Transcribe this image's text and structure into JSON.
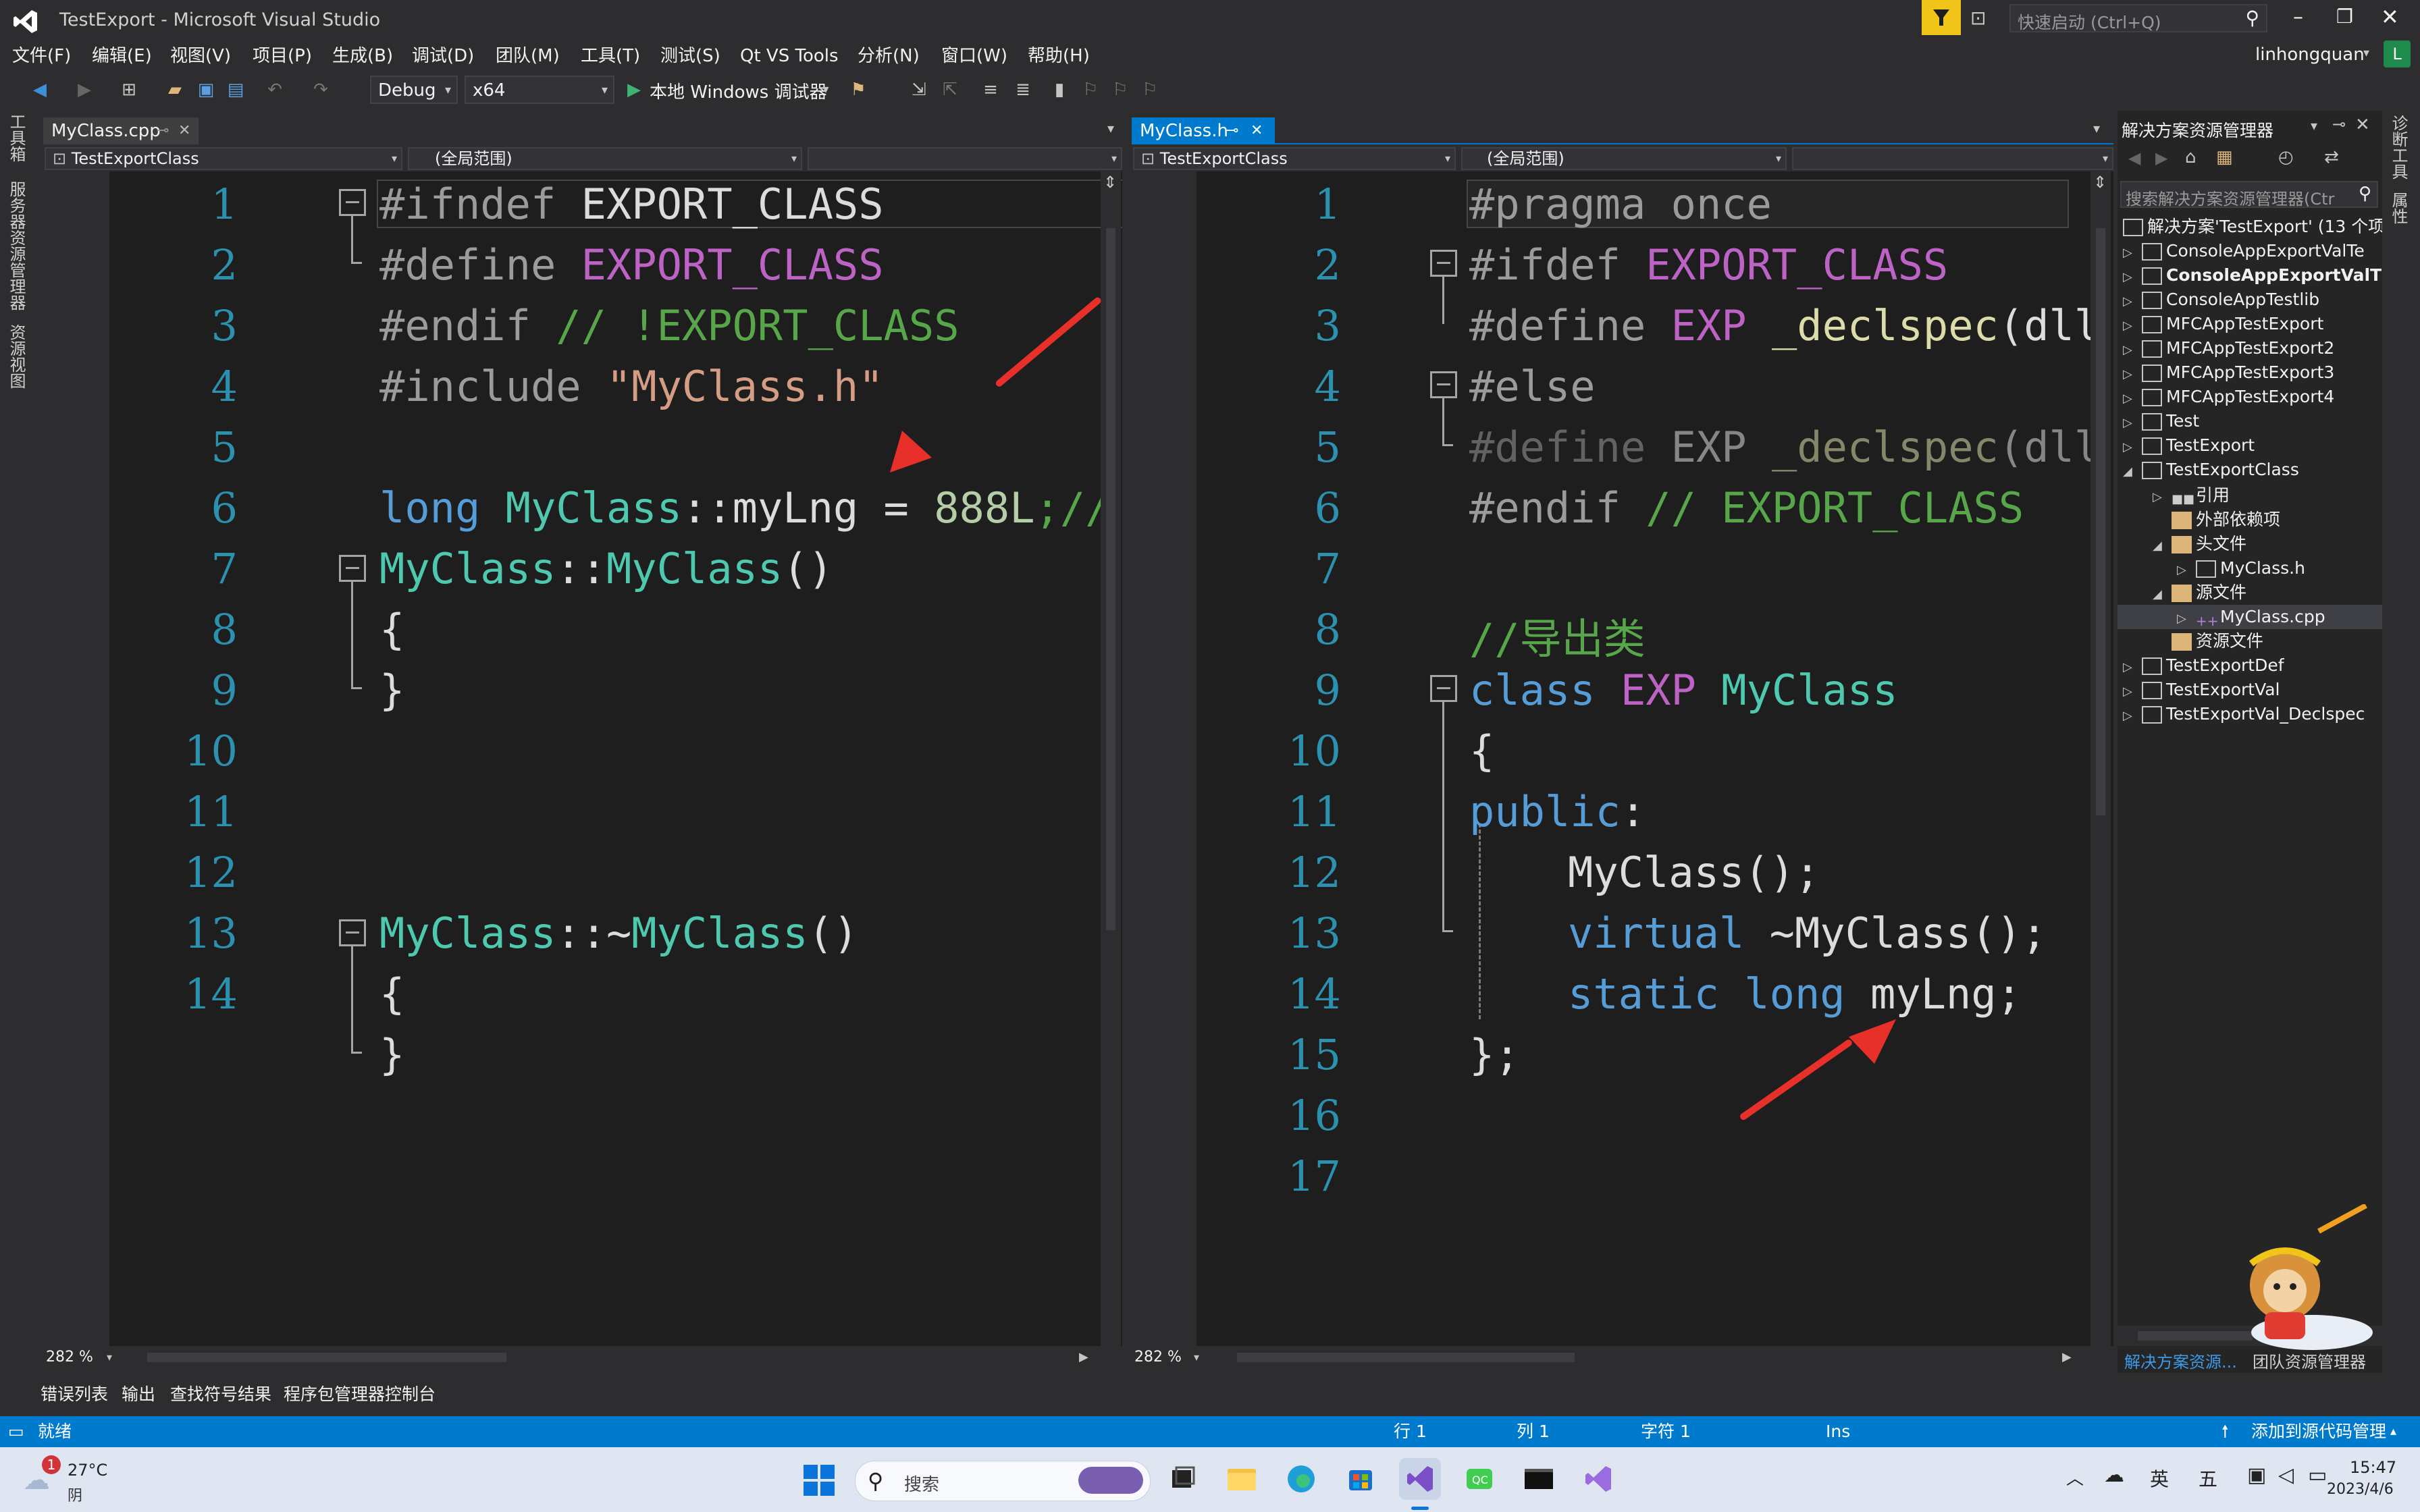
{
  "window": {
    "title": "TestExport - Microsoft Visual Studio",
    "quick_launch_placeholder": "快速启动 (Ctrl+Q)",
    "user": "linhongquan",
    "user_initial": "L"
  },
  "menu": [
    "文件(F)",
    "编辑(E)",
    "视图(V)",
    "项目(P)",
    "生成(B)",
    "调试(D)",
    "团队(M)",
    "工具(T)",
    "测试(S)",
    "Qt VS Tools",
    "分析(N)",
    "窗口(W)",
    "帮助(H)"
  ],
  "toolbar": {
    "config": "Debug",
    "platform": "x64",
    "debugger": "本地 Windows 调试器"
  },
  "left_strip": [
    "工具箱",
    "服务器资源管理器",
    "资源视图"
  ],
  "right_strip": [
    "诊断工具",
    "属性"
  ],
  "left_editor": {
    "tab": "MyClass.cpp",
    "nav_project": "TestExportClass",
    "nav_scope": "(全局范围)",
    "zoom": "282 %",
    "line_numbers": [
      "1",
      "2",
      "3",
      "4",
      "5",
      "6",
      "7",
      "8",
      "9",
      "10",
      "11",
      "12",
      "13",
      "14"
    ],
    "lines": {
      "l1": {
        "pp": "#ifndef ",
        "mac": "EXPORT_CLASS"
      },
      "l2": {
        "pp": "#define ",
        "mac": "EXPORT_CLASS"
      },
      "l3": {
        "pp": "#endif ",
        "cm": "// !EXPORT_CLASS"
      },
      "l4": {
        "pp": "#include ",
        "str": "\"MyClass.h\""
      },
      "l6": {
        "kw": "long ",
        "ty": "MyClass",
        "op": "::myLng = ",
        "num": "888L",
        "cm": ";//"
      },
      "l7": {
        "ty": "MyClass",
        "op": "::",
        "fn": "MyClass",
        "p": "()"
      },
      "l8": "{",
      "l9": "}",
      "l11": {
        "ty": "MyClass",
        "op": "::~",
        "fn": "MyClass",
        "p": "()"
      },
      "l12": "{",
      "l13": "}"
    }
  },
  "right_editor": {
    "tab": "MyClass.h",
    "nav_project": "TestExportClass",
    "nav_scope": "(全局范围)",
    "zoom": "282 %",
    "line_numbers": [
      "1",
      "2",
      "3",
      "4",
      "5",
      "6",
      "7",
      "8",
      "9",
      "10",
      "11",
      "12",
      "13",
      "14",
      "15",
      "16",
      "17"
    ],
    "lines": {
      "l1": {
        "pp": "#pragma once"
      },
      "l2": {
        "pp": "#ifdef ",
        "mac": "EXPORT_CLASS"
      },
      "l3": {
        "pp": "#define ",
        "mac": "EXP ",
        "fn": "_declspec",
        "p": "(dll"
      },
      "l4": {
        "pp": "#else"
      },
      "l5": {
        "pp": "#define ",
        "p1": "EXP ",
        "fn": "_declspec",
        "p": "(dll"
      },
      "l6": {
        "pp": "#endif ",
        "cm": "// EXPORT_CLASS"
      },
      "l8": {
        "cm": "//导出类"
      },
      "l9": {
        "kw": "class ",
        "mac": "EXP ",
        "ty": "MyClass"
      },
      "l10": "{",
      "l11": {
        "kw": "public",
        "p": ":"
      },
      "l12": {
        "fn": "MyClass",
        "p": "();"
      },
      "l13": {
        "kw": "virtual ",
        "fn": "~MyClass",
        "p": "();"
      },
      "l14": {
        "kw": "static long ",
        "p": "myLng;"
      },
      "l15": "};"
    }
  },
  "solution_explorer": {
    "title": "解决方案资源管理器",
    "search_placeholder": "搜索解决方案资源管理器(Ctr",
    "solution": "解决方案'TestExport' (13 个项",
    "items": [
      {
        "label": "ConsoleAppExportValTe",
        "bold": false
      },
      {
        "label": "ConsoleAppExportValT",
        "bold": true
      },
      {
        "label": "ConsoleAppTestlib",
        "bold": false
      },
      {
        "label": "MFCAppTestExport",
        "bold": false
      },
      {
        "label": "MFCAppTestExport2",
        "bold": false
      },
      {
        "label": "MFCAppTestExport3",
        "bold": false
      },
      {
        "label": "MFCAppTestExport4",
        "bold": false
      },
      {
        "label": "Test",
        "bold": false
      },
      {
        "label": "TestExport",
        "bold": false
      },
      {
        "label": "TestExportClass",
        "bold": false
      }
    ],
    "children": [
      "引用",
      "外部依赖项",
      "头文件",
      "MyClass.h",
      "源文件",
      "MyClass.cpp",
      "资源文件"
    ],
    "tail_items": [
      "TestExportDef",
      "TestExportVal",
      "TestExportVal_Declspec"
    ],
    "footer_tab": "解决方案资源...",
    "footer_tab2": "团队资源管理器"
  },
  "bottom_tabs": [
    "错误列表",
    "输出",
    "查找符号结果",
    "程序包管理器控制台"
  ],
  "status": {
    "ready": "就绪",
    "row": "行 1",
    "col": "列 1",
    "char": "字符 1",
    "ins": "Ins",
    "source_control": "添加到源代码管理"
  },
  "taskbar": {
    "weather_temp": "27°C",
    "weather_desc": "阴",
    "weather_badge": "1",
    "search": "搜索",
    "ime1": "英",
    "ime2": "五",
    "time": "15:47",
    "date": "2023/4/6"
  },
  "colors": {
    "accent": "#007acc",
    "keyword": "#569cd6",
    "type": "#4ec9b0",
    "macro": "#bd63c5",
    "string": "#d69d85",
    "comment": "#57a64a",
    "line_number": "#2b91af",
    "annotation_arrow": "#e8302a"
  }
}
